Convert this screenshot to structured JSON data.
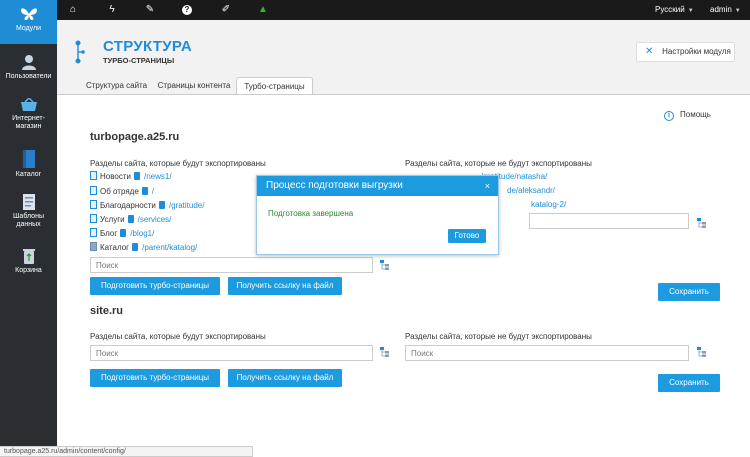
{
  "topbar": {
    "icons": [
      "home-icon",
      "bolt-icon",
      "pencil-icon",
      "help-icon",
      "brush-icon",
      "warning-icon"
    ],
    "language": "Русский",
    "user": "admin"
  },
  "sidebar": {
    "items": [
      {
        "label": "Модули",
        "icon": "butterfly-icon",
        "active": true
      },
      {
        "label": "Пользователи",
        "icon": "user-icon"
      },
      {
        "label": "Интернет-\nмагазин",
        "icon": "basket-icon"
      },
      {
        "label": "Каталог",
        "icon": "book-icon"
      },
      {
        "label": "Шаблоны\nданных",
        "icon": "templates-icon"
      },
      {
        "label": "Корзина",
        "icon": "recycle-icon"
      }
    ]
  },
  "header": {
    "title": "СТРУКТУРА",
    "subtitle": "ТУРБО-СТРАНИЦЫ",
    "module_settings": "Настройки модуля"
  },
  "tabs": [
    {
      "label": "Структура сайта"
    },
    {
      "label": "Страницы контента"
    },
    {
      "label": "Турбо-страницы",
      "active": true
    }
  ],
  "help": "Помощь",
  "sites": [
    {
      "name": "turbopage.a25.ru",
      "exported_label": "Разделы сайта, которые будут экспортированы",
      "not_exported_label": "Разделы сайта, которые не будут экспортированы",
      "exported": [
        {
          "name": "Новости",
          "path": "/news1/"
        },
        {
          "name": "Об отряде",
          "path": "/"
        },
        {
          "name": "Благодарности",
          "path": "/gratitude/"
        },
        {
          "name": "Услуги",
          "path": "/services/"
        },
        {
          "name": "Блог",
          "path": "/blog1/"
        },
        {
          "name": "Каталог",
          "path": "/parent/katalog/"
        }
      ],
      "not_exported_visible": [
        "/gratitude/natasha/",
        "de/aleksandr/",
        "katalog-2/"
      ],
      "search_placeholder": "Поиск",
      "prepare_button": "Подготовить турбо-страницы",
      "link_button": "Получить ссылку на файл",
      "save_button": "Сохранить"
    },
    {
      "name": "site.ru",
      "exported_label": "Разделы сайта, которые будут экспортированы",
      "not_exported_label": "Разделы сайта, которые не будут экспортированы",
      "search_placeholder": "Поиск",
      "prepare_button": "Подготовить турбо-страницы",
      "link_button": "Получить ссылку на файл",
      "save_button": "Сохранить"
    }
  ],
  "modal": {
    "title": "Процесс подготовки выгрузки",
    "close": "×",
    "message": "Подготовка завершена",
    "ok": "Готово"
  },
  "status_url": "turbopage.a25.ru/admin/content/config/",
  "colors": {
    "accent": "#1d9be0",
    "sidebar": "#2a2e33",
    "topbar": "#1a1a1a",
    "success": "#2a8a2a"
  }
}
